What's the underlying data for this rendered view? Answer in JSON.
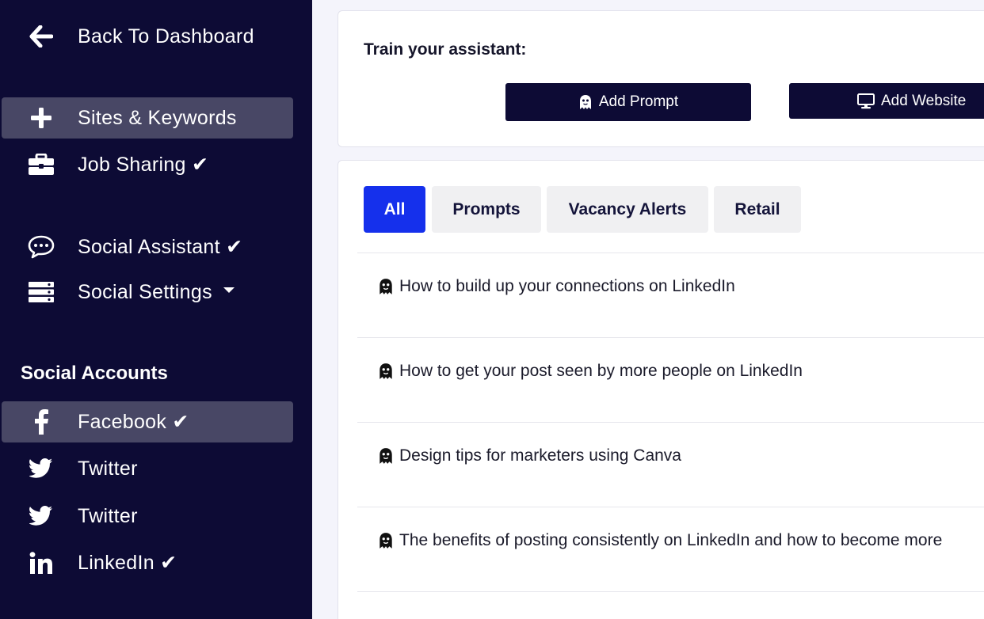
{
  "sidebar": {
    "back": {
      "label": "Back To Dashboard",
      "icon": "arrow-left-icon"
    },
    "items": [
      {
        "label": "Sites & Keywords",
        "icon": "plus-icon",
        "active": true
      },
      {
        "label": "Job Sharing ✔",
        "icon": "briefcase-icon"
      },
      {
        "label": "Social Assistant ✔",
        "icon": "chat-bubble-icon"
      },
      {
        "label": "Social Settings",
        "icon": "server-icon"
      }
    ],
    "accounts_title": "Social Accounts",
    "accounts": [
      {
        "label": "Facebook ✔",
        "icon": "facebook-icon",
        "active": true
      },
      {
        "label": "Twitter",
        "icon": "twitter-icon"
      },
      {
        "label": "Twitter",
        "icon": "twitter-icon"
      },
      {
        "label": "LinkedIn ✔",
        "icon": "linkedin-icon"
      }
    ]
  },
  "train": {
    "title": "Train your assistant:",
    "add_prompt": "Add Prompt",
    "add_website": "Add Website"
  },
  "tabs": [
    "All",
    "Prompts",
    "Vacancy Alerts",
    "Retail"
  ],
  "active_tab": "All",
  "prompts": [
    "How to build up your connections on LinkedIn",
    "How to get your post seen by more people on LinkedIn",
    "Design tips for marketers using Canva",
    "The benefits of posting consistently on LinkedIn and how to become more"
  ],
  "colors": {
    "sidebar_bg": "#0d0b35",
    "active_item": "#484765",
    "accent_blue": "#1530ec",
    "page_bg": "#f4f4fb"
  }
}
